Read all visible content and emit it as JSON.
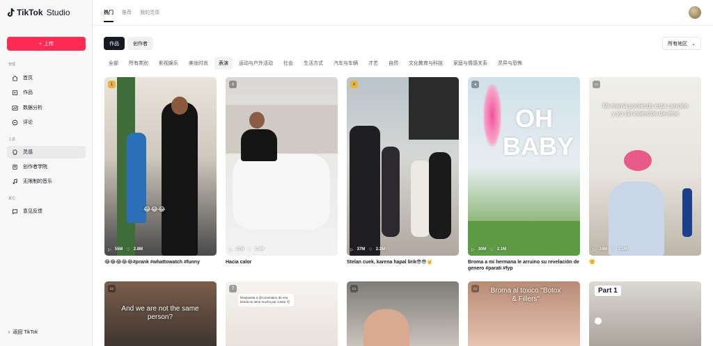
{
  "app": {
    "name": "TikTok",
    "suffix": "Studio"
  },
  "sidebar": {
    "upload_label": "上传",
    "section_manage": "管理",
    "section_tools": "工具",
    "section_other": "其它",
    "items": [
      {
        "label": "首页",
        "icon": "home-icon"
      },
      {
        "label": "作品",
        "icon": "posts-icon"
      },
      {
        "label": "数据分析",
        "icon": "analytics-icon"
      },
      {
        "label": "评论",
        "icon": "comment-icon"
      },
      {
        "label": "灵感",
        "icon": "inspiration-icon"
      },
      {
        "label": "创作者学院",
        "icon": "academy-icon"
      },
      {
        "label": "无限制的音乐",
        "icon": "music-icon"
      },
      {
        "label": "意见反馈",
        "icon": "feedback-icon"
      }
    ],
    "back_label": "返回 TikTok"
  },
  "top_tabs": [
    "热门",
    "推荐",
    "我的灵感"
  ],
  "segment": [
    "作品",
    "创作者"
  ],
  "region_label": "所有地区",
  "categories": [
    "全部",
    "所有类别",
    "影视娱乐",
    "美妆时尚",
    "表演",
    "运动与户外活动",
    "社会",
    "生活方式",
    "汽车与车辆",
    "才艺",
    "自然",
    "文化教育与科技",
    "家庭与情感关系",
    "灵异与恐怖"
  ],
  "cards": [
    {
      "badge": "1",
      "views": "55M",
      "likes": "2.8M",
      "caption": "😂😂😂😂😂#prank #whattowatch #funny",
      "overlay": "😂😂😂"
    },
    {
      "badge": "≡",
      "views": "41M",
      "likes": "1.9M",
      "caption": "Hacia calor"
    },
    {
      "badge": "≡",
      "views": "37M",
      "likes": "2.2M",
      "caption": "Stelan cuek, karena hapal lirik😎😎🤘"
    },
    {
      "badge": "◂",
      "views": "30M",
      "likes": "2.1M",
      "caption": "Broma a mi hermana le arruino su revelación de genero #parati #fyp",
      "overlay": "OH BABY"
    },
    {
      "badge": "▭",
      "views": "24M",
      "likes": "2.1M",
      "caption": "🙂",
      "overlay": "Mi mamá poniendo esta canción y yo sin intención de irme"
    }
  ],
  "cards_row2": [
    {
      "badge": "▭",
      "overlay": "And we are not the same person?"
    },
    {
      "badge": "7",
      "overlay": "Respuesta a @comentario de esa tienda se tiene mucho por contar 😊"
    },
    {
      "badge": "▭",
      "overlay": ""
    },
    {
      "badge": "▭",
      "overlay": "Broma al toxico \"Botox & Fillers\""
    },
    {
      "badge": "",
      "overlay": "Part 1"
    }
  ]
}
